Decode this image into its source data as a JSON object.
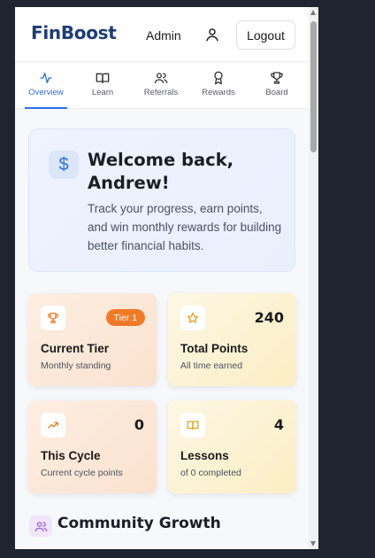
{
  "header": {
    "logo": "FinBoost",
    "role": "Admin",
    "logout_label": "Logout"
  },
  "tabs": [
    {
      "label": "Overview",
      "icon": "activity-icon",
      "active": true
    },
    {
      "label": "Learn",
      "icon": "book-icon",
      "active": false
    },
    {
      "label": "Referrals",
      "icon": "users-icon",
      "active": false
    },
    {
      "label": "Rewards",
      "icon": "award-icon",
      "active": false
    },
    {
      "label": "Board",
      "icon": "trophy-icon",
      "active": false
    }
  ],
  "welcome": {
    "icon": "dollar-icon",
    "title": "Welcome back, Andrew!",
    "text": "Track your progress, earn points, and win monthly rewards for building better financial habits."
  },
  "stats": [
    {
      "title": "Current Tier",
      "subtitle": "Monthly standing",
      "badge": "Tier 1",
      "icon": "trophy-icon"
    },
    {
      "title": "Total Points",
      "subtitle": "All time earned",
      "value": "240",
      "icon": "star-icon"
    },
    {
      "title": "This Cycle",
      "subtitle": "Current cycle points",
      "value": "0",
      "icon": "trending-up-icon"
    },
    {
      "title": "Lessons",
      "subtitle": "of 0 completed",
      "value": "4",
      "icon": "book-icon"
    }
  ],
  "section": {
    "title": "Community Growth",
    "icon": "users-icon"
  },
  "colors": {
    "brand": "#1f3c73",
    "accent": "#2f6fe0",
    "badge": "#f07a26"
  }
}
